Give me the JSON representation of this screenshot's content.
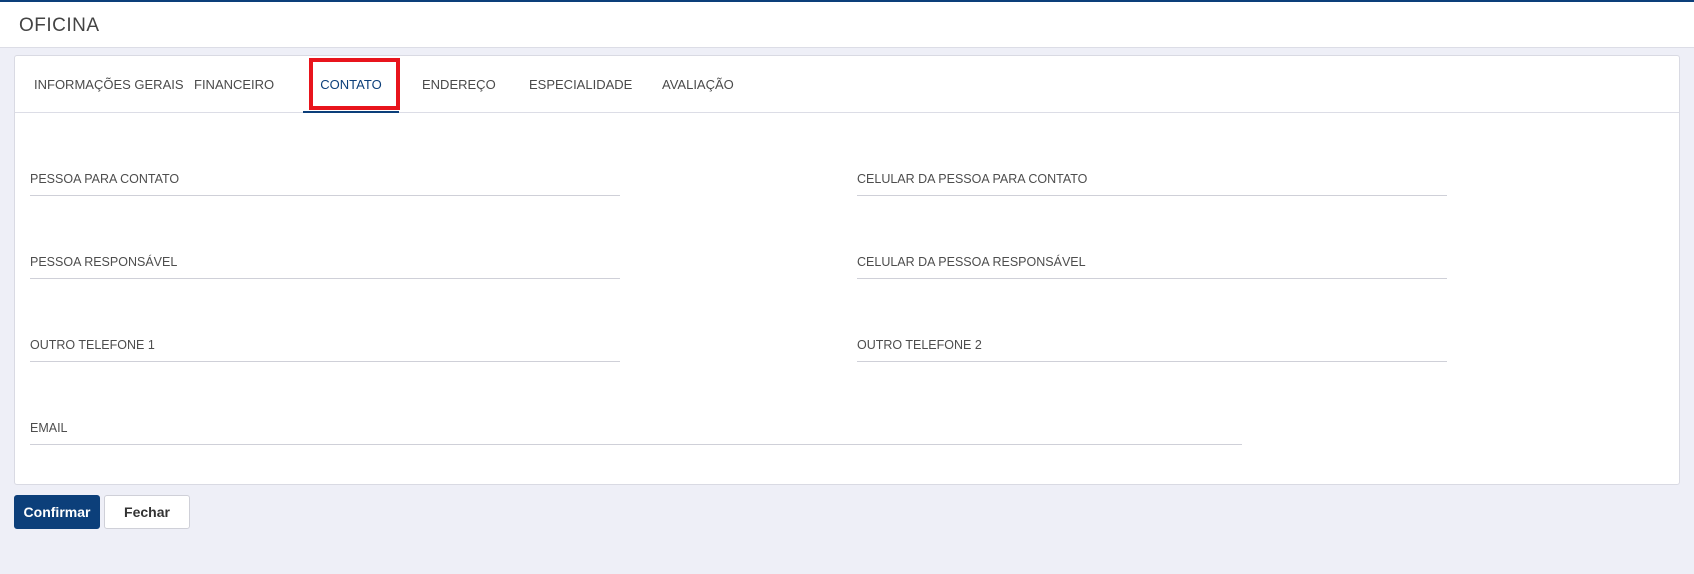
{
  "header": {
    "title": "OFICINA"
  },
  "tabs": [
    {
      "label": "INFORMAÇÕES GERAIS",
      "active": false
    },
    {
      "label": "FINANCEIRO",
      "active": false
    },
    {
      "label": "CONTATO",
      "active": true
    },
    {
      "label": "ENDEREÇO",
      "active": false
    },
    {
      "label": "ESPECIALIDADE",
      "active": false
    },
    {
      "label": "AVALIAÇÃO",
      "active": false
    }
  ],
  "form": {
    "contact_person": {
      "label": "PESSOA PARA CONTATO",
      "value": ""
    },
    "contact_person_mobile": {
      "label": "CELULAR DA PESSOA PARA CONTATO",
      "value": ""
    },
    "responsible_person": {
      "label": "PESSOA RESPONSÁVEL",
      "value": ""
    },
    "responsible_person_mobile": {
      "label": "CELULAR DA PESSOA RESPONSÁVEL",
      "value": ""
    },
    "other_phone_1": {
      "label": "OUTRO TELEFONE 1",
      "value": ""
    },
    "other_phone_2": {
      "label": "OUTRO TELEFONE 2",
      "value": ""
    },
    "email": {
      "label": "EMAIL",
      "value": ""
    }
  },
  "actions": {
    "confirm_label": "Confirmar",
    "close_label": "Fechar"
  },
  "colors": {
    "primary": "#0c3f7a",
    "highlight": "#e8141c",
    "background": "#eeeff7"
  }
}
